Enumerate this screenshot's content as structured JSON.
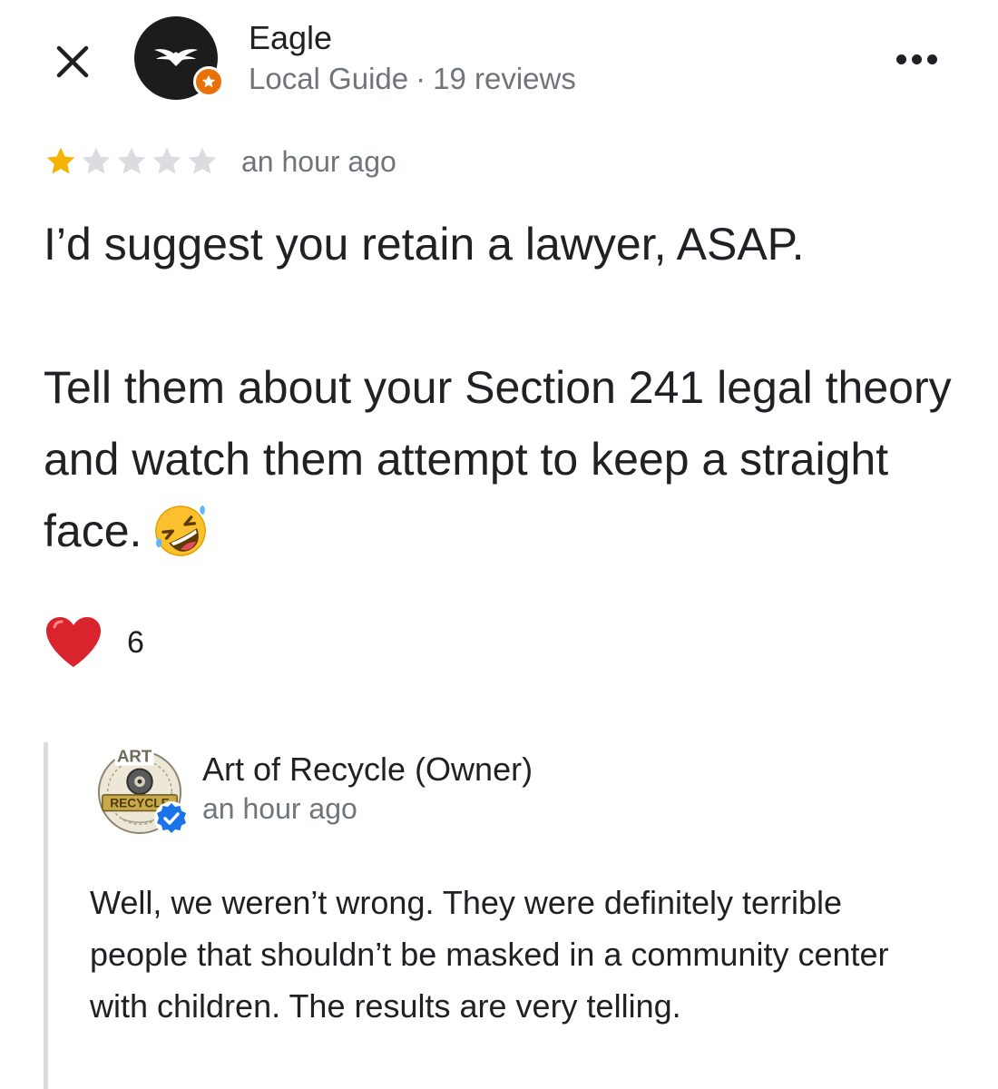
{
  "header": {
    "author_name": "Eagle",
    "author_badge": "Local Guide",
    "separator": "·",
    "review_count": "19 reviews",
    "avatar_icon": "eagle-wings-icon",
    "badge_icon": "local-guide-star-icon",
    "close_icon": "close-icon",
    "more_icon": "more-options-icon"
  },
  "review": {
    "rating": 1,
    "max_rating": 5,
    "time": "an hour ago",
    "paragraphs": [
      "I’d suggest you retain a lawyer, ASAP.",
      "Tell them about your Section 241 legal theory and watch them attempt to keep a straight face."
    ],
    "emoji": "rolling-on-floor-laughing-icon"
  },
  "reaction": {
    "icon": "heart-icon",
    "count": "6"
  },
  "owner_reply": {
    "name": "Art of Recycle (Owner)",
    "time": "an hour ago",
    "logo_lettering": [
      "ART",
      "RECYCLE"
    ],
    "verified_icon": "verified-check-icon",
    "text": "Well, we weren’t wrong. They were definitely terrible people that shouldn’t be masked in a community center with children. The results are very telling."
  },
  "colors": {
    "star_filled": "#f4b400",
    "star_empty": "#dadce0",
    "secondary_text": "#70757a",
    "badge_orange": "#e8710a",
    "verified_blue": "#1a73e8",
    "reply_rule": "#dadce0",
    "heart_red": "#d9242d"
  }
}
